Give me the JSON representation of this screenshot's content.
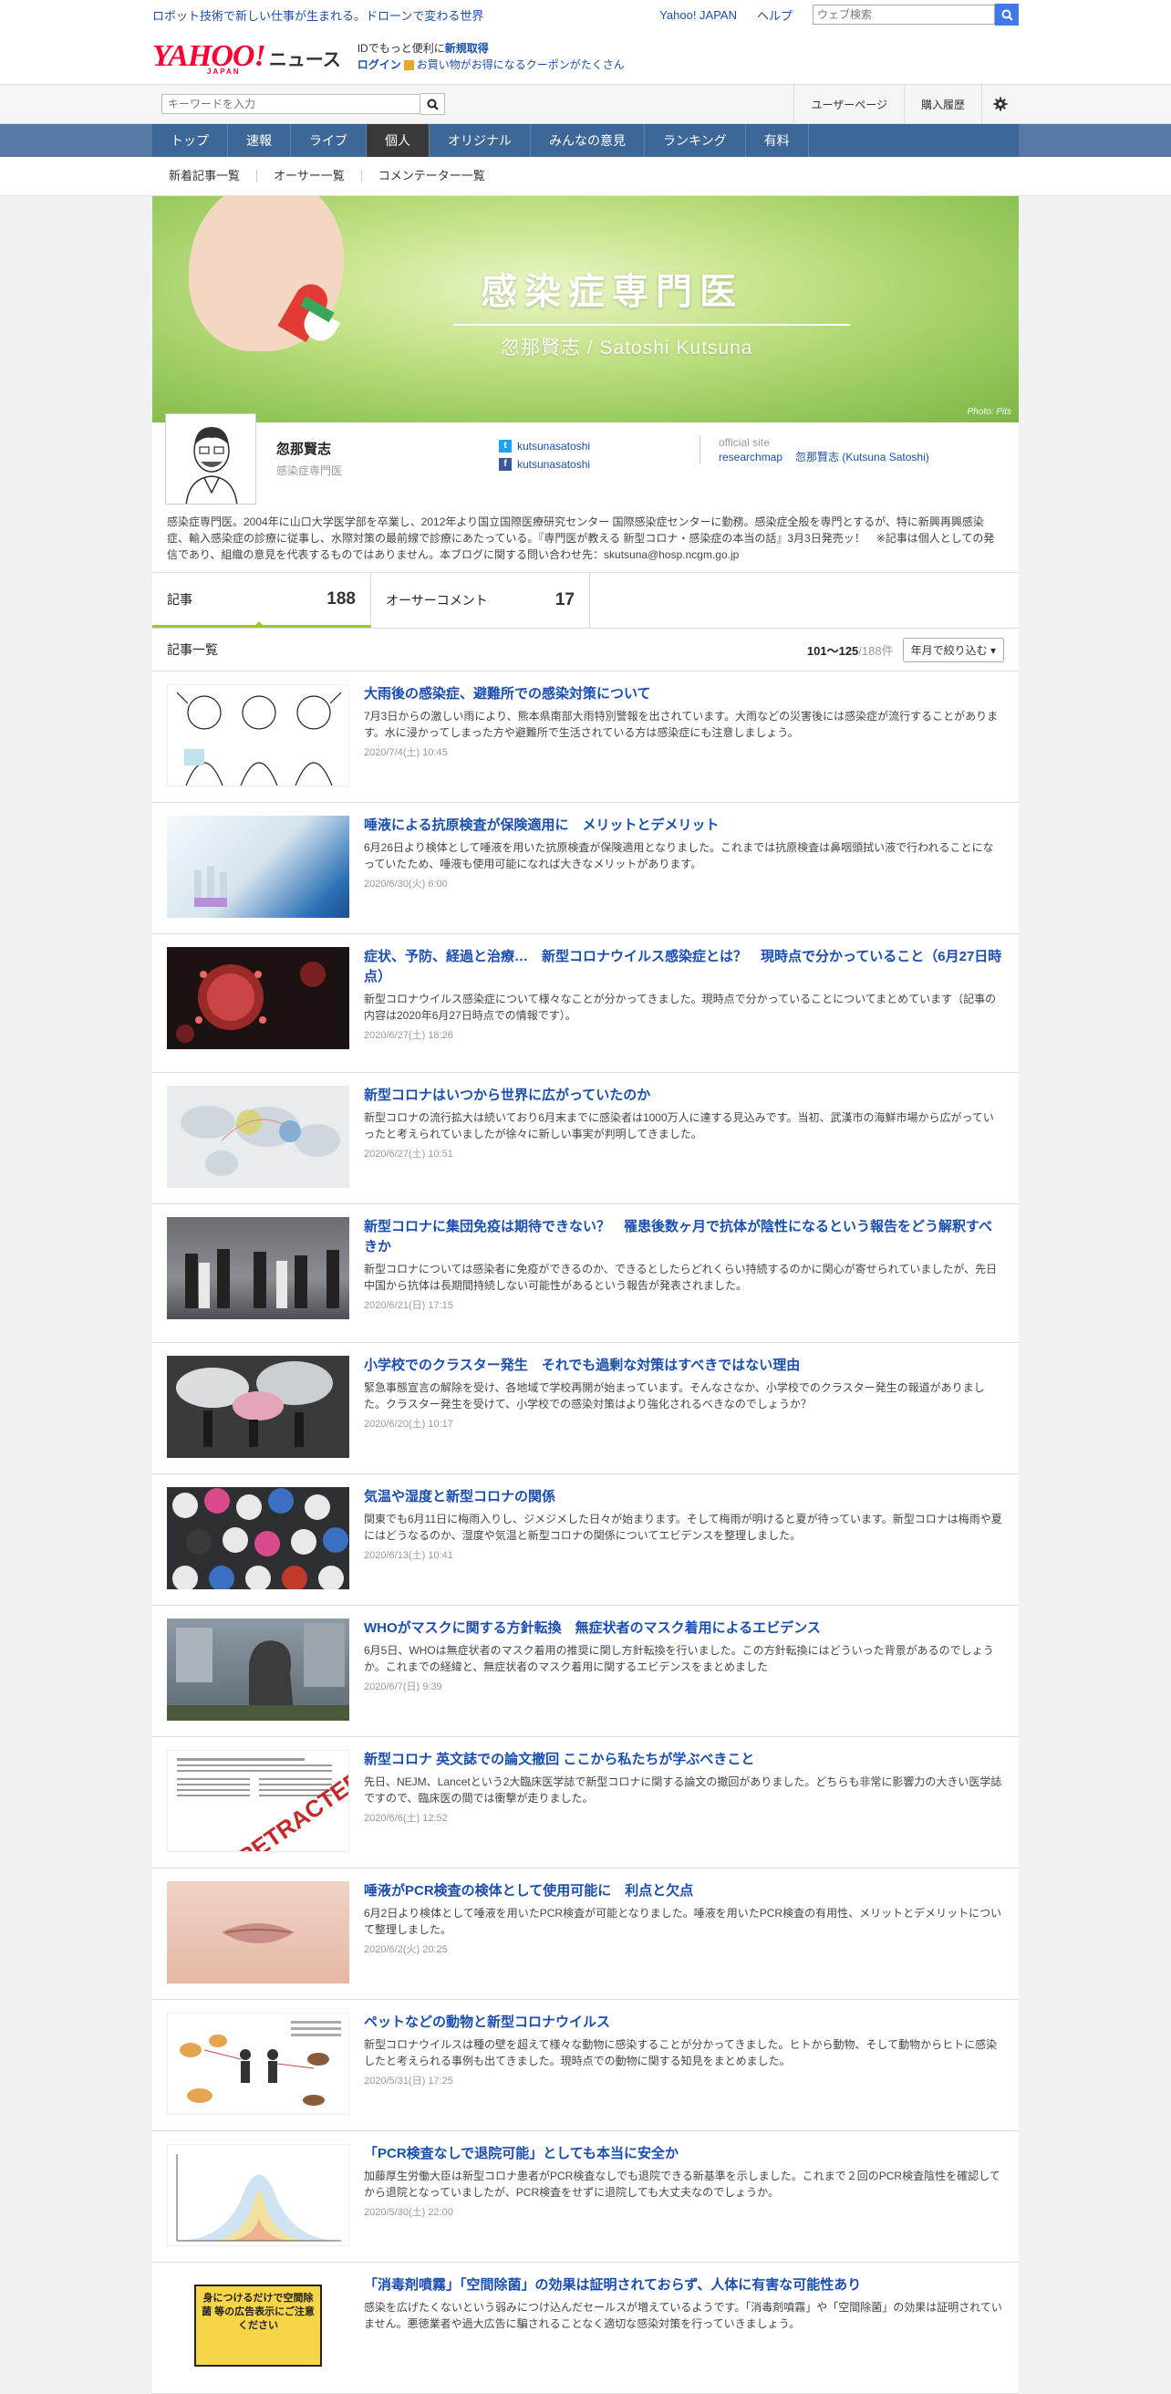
{
  "topbar": {
    "promo": "ロボット技術で新しい仕事が生まれる。ドローンで変わる世界",
    "links": [
      "Yahoo! JAPAN",
      "ヘルプ"
    ],
    "web_search_placeholder": "ウェブ検索"
  },
  "header": {
    "logo": "YAHOO!",
    "logo_sub": "JAPAN",
    "logo_news": "ニュース",
    "login_line1_prefix": "IDでもっと便利に",
    "login_line1_link": "新規取得",
    "login_link": "ログイン",
    "coupon_text": "お買い物がお得になるクーポンがたくさん"
  },
  "searchrow": {
    "keyword_placeholder": "キーワードを入力",
    "user_page": "ユーザーページ",
    "purchase_history": "購入履歴"
  },
  "gnav": [
    "トップ",
    "速報",
    "ライブ",
    "個人",
    "オリジナル",
    "みんなの意見",
    "ランキング",
    "有料"
  ],
  "subnav": [
    "新着記事一覧",
    "オーサー一覧",
    "コメンテーター一覧"
  ],
  "banner": {
    "title": "感染症専門医",
    "subtitle": "忽那賢志 / Satoshi Kutsuna",
    "credit": "Photo: Pits"
  },
  "profile": {
    "name": "忽那賢志",
    "title": "感染症専門医",
    "twitter": "kutsunasatoshi",
    "facebook": "kutsunasatoshi",
    "official_label": "official site",
    "official_links": [
      "researchmap",
      "忽那賢志 (Kutsuna Satoshi)"
    ],
    "intro": "感染症専門医。2004年に山口大学医学部を卒業し、2012年より国立国際医療研究センター 国際感染症センターに勤務。感染症全般を専門とするが、特に新興再興感染症、輸入感染症の診療に従事し、水際対策の最前線で診療にあたっている。『専門医が教える 新型コロナ・感染症の本当の話』3月3日発売ッ！　※記事は個人としての発信であり、組織の意見を代表するものではありません。本ブログに関する問い合わせ先：skutsuna@hosp.ncgm.go.jp"
  },
  "tabs": [
    {
      "label": "記事",
      "count": "188"
    },
    {
      "label": "オーサーコメント",
      "count": "17"
    }
  ],
  "list": {
    "heading": "記事一覧",
    "range": "101～125",
    "total": "/188件",
    "month_filter": "年月で絞り込む"
  },
  "articles": [
    {
      "title": "大雨後の感染症、避難所での感染対策について",
      "desc": "7月3日からの激しい雨により、熊本県南部大雨特別警報を出されています。大雨などの災害後には感染症が流行することがあります。水に浸かってしまった方や避難所で生活されている方は感染症にも注意しましょう。",
      "date": "2020/7/4(土) 10:45"
    },
    {
      "title": "唾液による抗原検査が保険適用に　メリットとデメリット",
      "desc": "6月26日より検体として唾液を用いた抗原検査が保険適用となりました。これまでは抗原検査は鼻咽頭拭い液で行われることになっていたため、唾液も使用可能になれば大きなメリットがあります。",
      "date": "2020/6/30(火) 6:00"
    },
    {
      "title": "症状、予防、経過と治療…　新型コロナウイルス感染症とは？　現時点で分かっていること（6月27日時点）",
      "desc": "新型コロナウイルス感染症について様々なことが分かってきました。現時点で分かっていることについてまとめています（記事の内容は2020年6月27日時点での情報です）。",
      "date": "2020/6/27(土) 18:26"
    },
    {
      "title": "新型コロナはいつから世界に広がっていたのか",
      "desc": "新型コロナの流行拡大は続いており6月末までに感染者は1000万人に達する見込みです。当初、武漢市の海鮮市場から広がっていったと考えられていましたが徐々に新しい事実が判明してきました。",
      "date": "2020/6/27(土) 10:51"
    },
    {
      "title": "新型コロナに集団免疫は期待できない？　罹患後数ヶ月で抗体が陰性になるという報告をどう解釈すべきか",
      "desc": "新型コロナについては感染者に免疫ができるのか、できるとしたらどれくらい持続するのかに関心が寄せられていましたが、先日中国から抗体は長期間持続しない可能性があるという報告が発表されました。",
      "date": "2020/6/21(日) 17:15"
    },
    {
      "title": "小学校でのクラスター発生　それでも過剰な対策はすべきではない理由",
      "desc": "緊急事態宣言の解除を受け、各地域で学校再開が始まっています。そんなさなか、小学校でのクラスター発生の報道がありました。クラスター発生を受けて、小学校での感染対策はより強化されるべきなのでしょうか？",
      "date": "2020/6/20(土) 10:17"
    },
    {
      "title": "気温や湿度と新型コロナの関係",
      "desc": "関東でも6月11日に梅雨入りし、ジメジメした日々が始まります。そして梅雨が明けると夏が待っています。新型コロナは梅雨や夏にはどうなるのか、湿度や気温と新型コロナの関係についてエビデンスを整理しました。",
      "date": "2020/6/13(土) 10:41"
    },
    {
      "title": "WHOがマスクに関する方針転換　無症状者のマスク着用によるエビデンス",
      "desc": "6月5日、WHOは無症状者のマスク着用の推奨に関し方針転換を行いました。この方針転換にはどういった背景があるのでしょうか。これまでの経緯と、無症状者のマスク着用に関するエビデンスをまとめました",
      "date": "2020/6/7(日) 9:39"
    },
    {
      "title": "新型コロナ 英文誌での論文撤回 ここから私たちが学ぶべきこと",
      "desc": "先日、NEJM、Lancetという2大臨床医学誌で新型コロナに関する論文の撤回がありました。どちらも非常に影響力の大きい医学誌ですので、臨床医の間では衝撃が走りました。",
      "date": "2020/6/6(土) 12:52"
    },
    {
      "title": "唾液がPCR検査の検体として使用可能に　利点と欠点",
      "desc": "6月2日より検体として唾液を用いたPCR検査が可能となりました。唾液を用いたPCR検査の有用性、メリットとデメリットについて整理しました。",
      "date": "2020/6/2(火) 20:25"
    },
    {
      "title": "ペットなどの動物と新型コロナウイルス",
      "desc": "新型コロナウイルスは種の壁を超えて様々な動物に感染することが分かってきました。ヒトから動物、そして動物からヒトに感染したと考えられる事例も出てきました。現時点での動物に関する知見をまとめました。",
      "date": "2020/5/31(日) 17:25"
    },
    {
      "title": "「PCR検査なしで退院可能」としても本当に安全か",
      "desc": "加藤厚生労働大臣は新型コロナ患者がPCR検査なしでも退院できる新基準を示しました。これまで２回のPCR検査陰性を確認してから退院となっていましたが、PCR検査をせずに退院しても大丈夫なのでしょうか。",
      "date": "2020/5/30(土) 22:00"
    },
    {
      "title": "「消毒剤噴霧」「空間除菌」の効果は証明されておらず、人体に有害な可能性あり",
      "desc": "感染を広げたくないという弱みにつけ込んだセールスが増えているようです。「消毒剤噴霧」や「空間除菌」の効果は証明されていません。悪徳業者や過大広告に騙されることなく適切な感染対策を行っていきましょう。",
      "date": ""
    }
  ],
  "thumb_labels": {
    "retracted": "RETRACTED",
    "sign": "身につけるだけで空間除菌 等の広告表示にご注意ください"
  }
}
